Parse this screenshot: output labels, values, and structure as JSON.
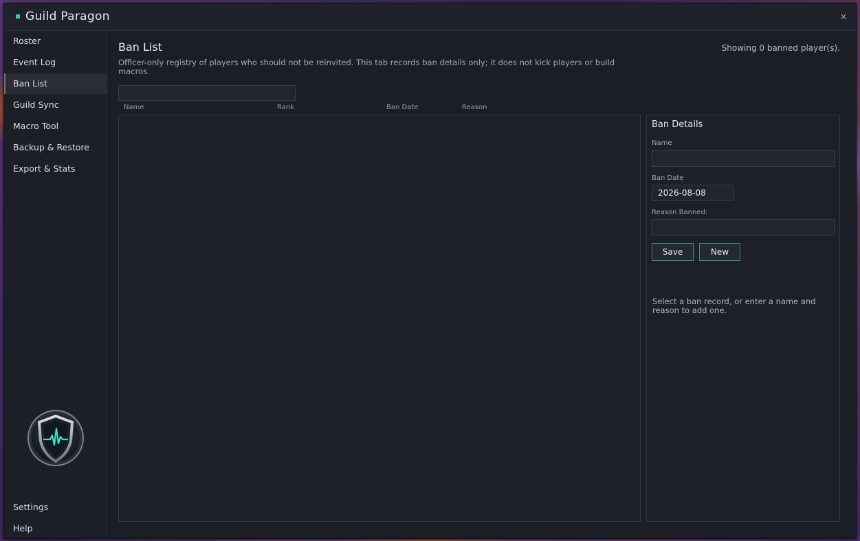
{
  "window": {
    "title": "Guild Paragon",
    "close": "×"
  },
  "sidebar": {
    "items": [
      {
        "label": "Roster"
      },
      {
        "label": "Event Log"
      },
      {
        "label": "Ban List"
      },
      {
        "label": "Guild Sync"
      },
      {
        "label": "Macro Tool"
      },
      {
        "label": "Backup & Restore"
      },
      {
        "label": "Export & Stats"
      }
    ],
    "bottom": [
      {
        "label": "Settings"
      },
      {
        "label": "Help"
      }
    ],
    "active": "Ban List",
    "logo_icon": "shield-heartbeat-icon"
  },
  "main": {
    "title": "Ban List",
    "description": "Officer-only registry of players who should not be reinvited. This tab records ban details only; it does not kick players or build macros.",
    "count_text": "Showing 0 banned player(s).",
    "search": {
      "value": "",
      "placeholder": ""
    },
    "columns": [
      "Name",
      "Rank",
      "Ban Date",
      "Reason"
    ],
    "rows": []
  },
  "details": {
    "title": "Ban Details",
    "name_label": "Name",
    "name_value": "",
    "date_label": "Ban Date",
    "date_value": "2026-08-08",
    "reason_label": "Reason Banned:",
    "reason_value": "",
    "save_label": "Save",
    "new_label": "New",
    "hint": "Select a ban record, or enter a name and reason to add one."
  },
  "colors": {
    "accent": "#3fc7b4",
    "button_border": "#3c8f88"
  }
}
